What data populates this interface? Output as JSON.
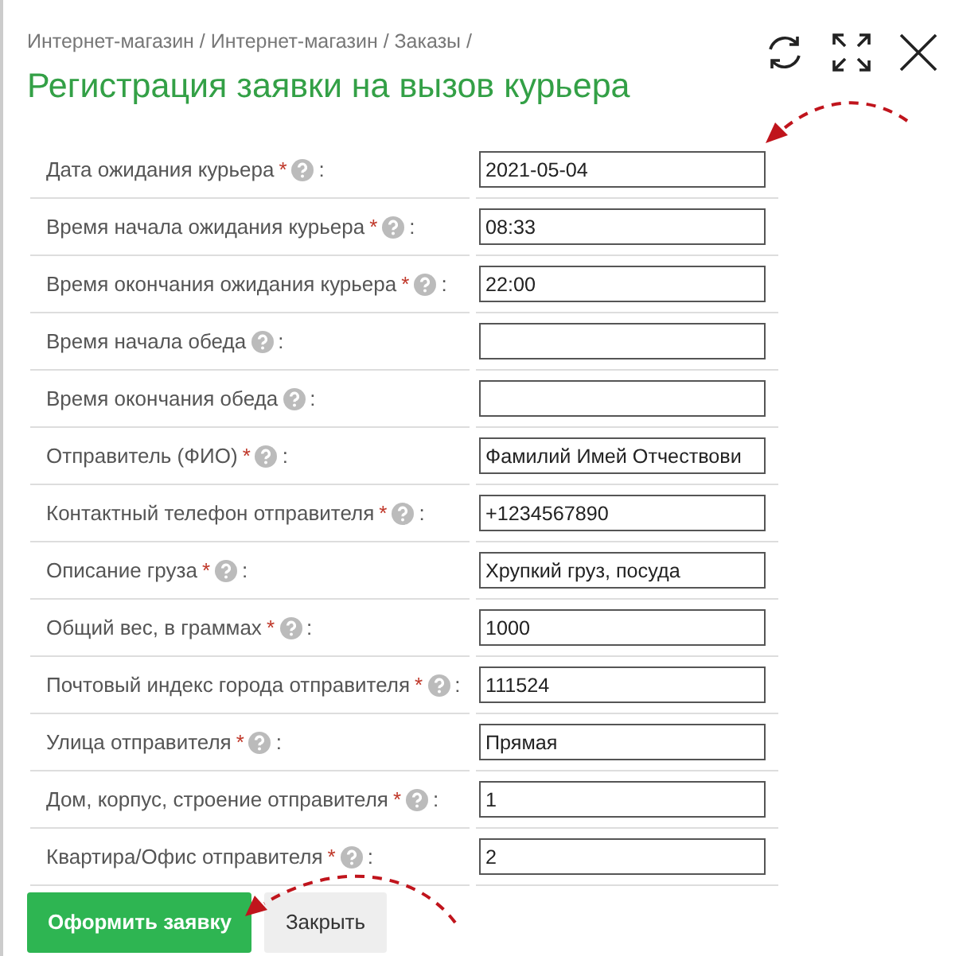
{
  "breadcrumb": "Интернет-магазин / Интернет-магазин / Заказы /",
  "title": "Регистрация заявки на вызов курьера",
  "fields": [
    {
      "label": "Дата ожидания курьера",
      "required": true,
      "value": "2021-05-04"
    },
    {
      "label": "Время начала ожидания курьера",
      "required": true,
      "value": "08:33"
    },
    {
      "label": "Время окончания ожидания курьера",
      "required": true,
      "value": "22:00"
    },
    {
      "label": "Время начала обеда",
      "required": false
    },
    {
      "label": "Время окончания обеда",
      "required": false
    },
    {
      "label": "Отправитель (ФИО)",
      "required": true,
      "value": "Фамилий Имей Отчествови"
    },
    {
      "label": "Контактный телефон отправителя",
      "required": true,
      "value": "+1234567890"
    },
    {
      "label": "Описание груза",
      "required": true,
      "value": "Хрупкий груз, посуда"
    },
    {
      "label": "Общий вес, в граммах",
      "required": true,
      "value": "1000"
    },
    {
      "label": "Почтовый индекс города отправителя",
      "required": true,
      "value": "111524"
    },
    {
      "label": "Улица отправителя",
      "required": true,
      "value": "Прямая"
    },
    {
      "label": "Дом, корпус, строение отправителя",
      "required": true,
      "value": "1"
    },
    {
      "label": "Квартира/Офис отправителя",
      "required": true,
      "value": "2"
    }
  ],
  "required_mark": "*",
  "label_suffix": ":",
  "buttons": [
    {
      "label": "Оформить заявку",
      "kind": "primary"
    },
    {
      "label": "Закрыть",
      "kind": "secondary"
    }
  ]
}
